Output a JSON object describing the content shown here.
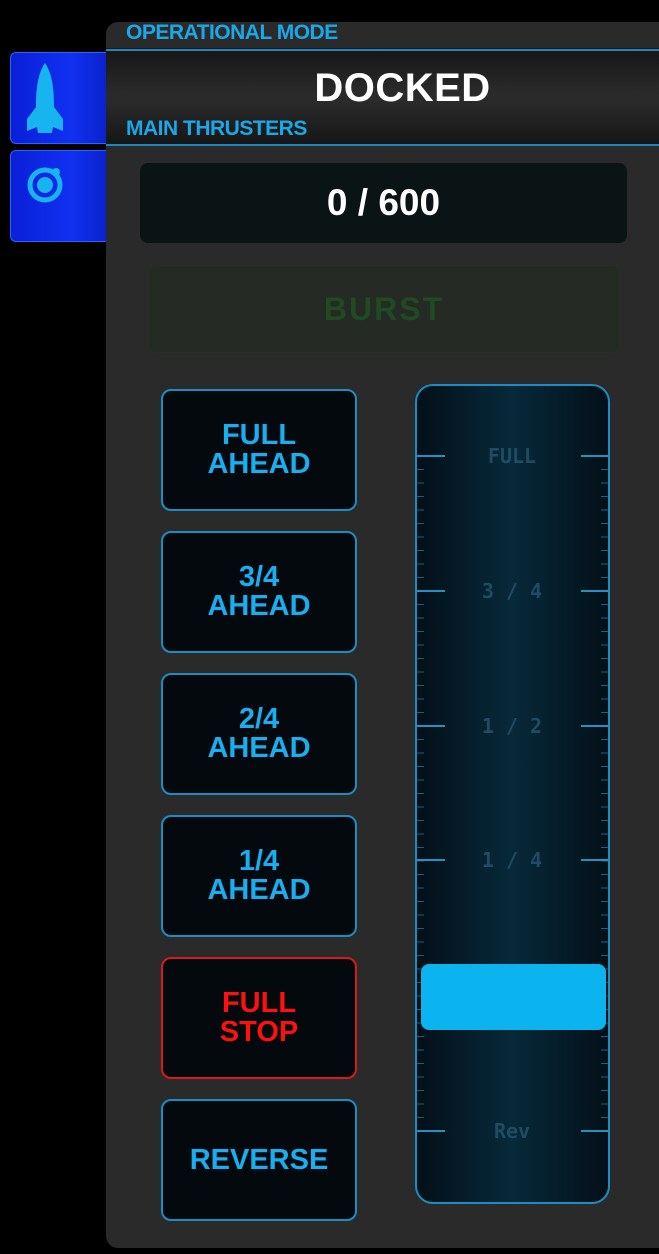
{
  "side_tabs": [
    {
      "name": "ship-icon"
    },
    {
      "name": "orbit-icon"
    }
  ],
  "header": {
    "mode_label": "OPERATIONAL MODE",
    "mode_value": "DOCKED",
    "thrusters_label": "MAIN THRUSTERS"
  },
  "thrusters": {
    "readout": "0 / 600",
    "burst_label": "BURST",
    "orders": [
      {
        "line1": "FULL",
        "line2": "AHEAD"
      },
      {
        "line1": "3/4",
        "line2": "AHEAD"
      },
      {
        "line1": "2/4",
        "line2": "AHEAD"
      },
      {
        "line1": "1/4",
        "line2": "AHEAD"
      },
      {
        "line1": "FULL",
        "line2": "STOP"
      },
      {
        "line1": "REVERSE",
        "line2": ""
      }
    ],
    "scale_labels": [
      "FULL",
      "3 / 4",
      "1 / 2",
      "1 / 4",
      "Rev"
    ],
    "throttle_level": 0
  },
  "colors": {
    "accent": "#1aa8e8",
    "stop": "#ff1010",
    "burst_disabled": "#1f4a22",
    "tab_blue": "#1130f0"
  }
}
